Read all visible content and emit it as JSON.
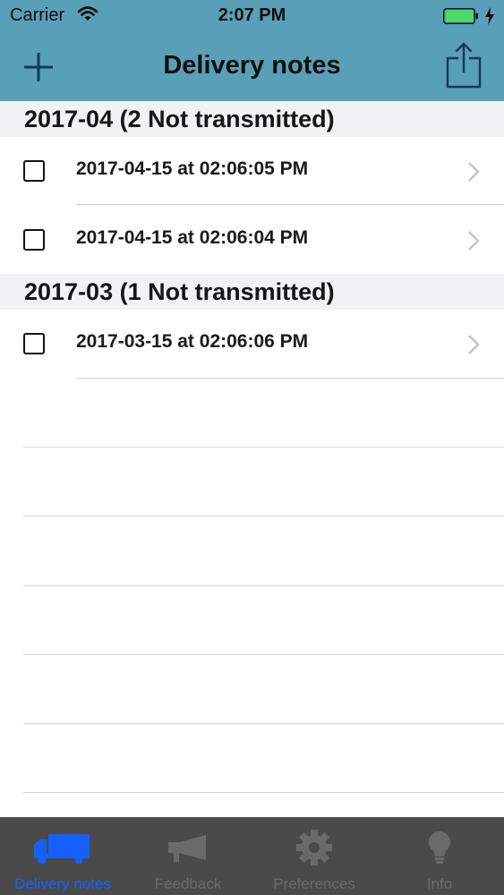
{
  "status_bar": {
    "carrier": "Carrier",
    "time": "2:07 PM"
  },
  "nav": {
    "title": "Delivery notes",
    "add_icon": "plus-icon",
    "share_icon": "share-icon"
  },
  "sections": [
    {
      "header": "2017-04 (2 Not transmitted)",
      "rows": [
        {
          "label": "2017-04-15 at 02:06:05 PM",
          "checked": false
        },
        {
          "label": "2017-04-15 at 02:06:04 PM",
          "checked": false
        }
      ]
    },
    {
      "header": "2017-03 (1 Not transmitted)",
      "rows": [
        {
          "label": "2017-03-15 at 02:06:06 PM",
          "checked": false
        }
      ]
    }
  ],
  "tab_bar": {
    "items": [
      {
        "label": "Delivery notes",
        "icon": "truck-icon",
        "active": true
      },
      {
        "label": "Feedback",
        "icon": "megaphone-icon",
        "active": false
      },
      {
        "label": "Preferences",
        "icon": "gear-icon",
        "active": false
      },
      {
        "label": "Info",
        "icon": "lightbulb-icon",
        "active": false
      }
    ]
  },
  "colors": {
    "nav_background": "#5a9fb8",
    "section_background": "#f2f2f4",
    "tab_bar_background": "#4a4a4a",
    "tab_active": "#1560ff",
    "tab_inactive": "#6a6a6a",
    "battery_fill": "#4cd964"
  }
}
